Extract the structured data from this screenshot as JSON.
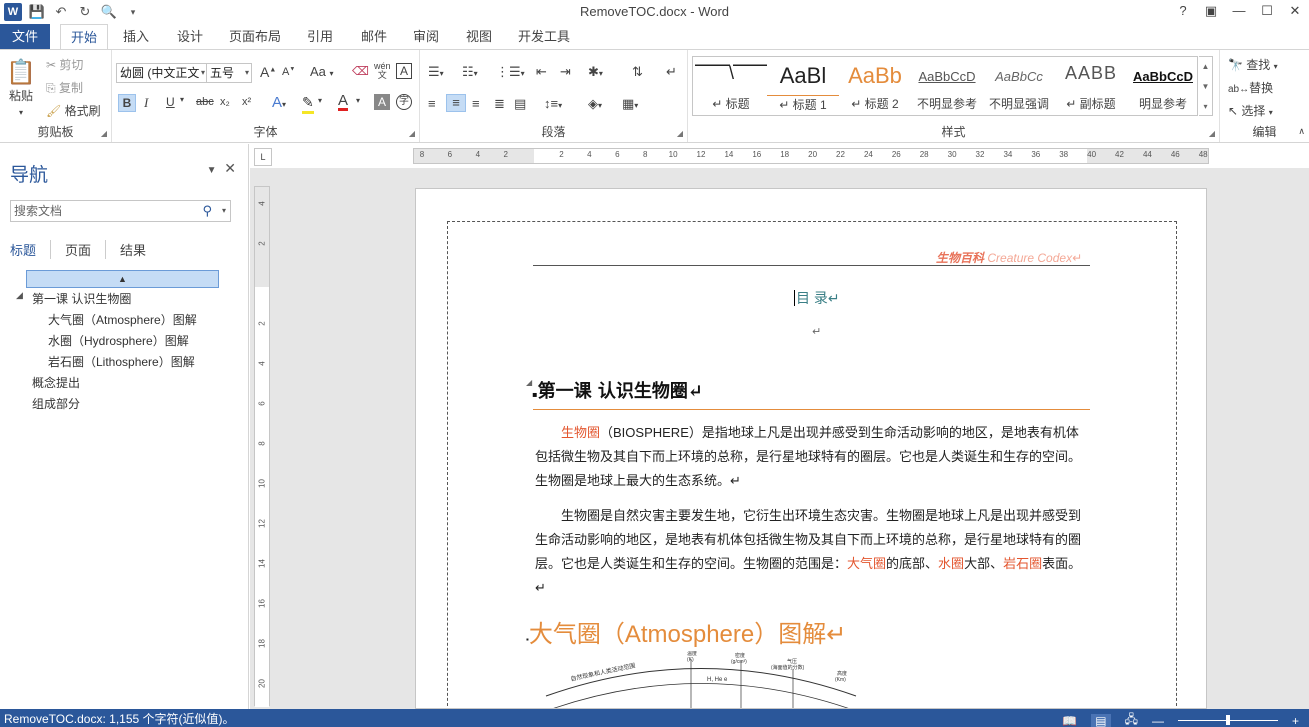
{
  "window": {
    "title": "RemoveTOC.docx - Word",
    "help": "?",
    "controls": [
      "?",
      "▣",
      "—",
      "☐",
      "✕"
    ]
  },
  "tabs": [
    "文件",
    "开始",
    "插入",
    "设计",
    "页面布局",
    "引用",
    "邮件",
    "审阅",
    "视图",
    "开发工具"
  ],
  "ribbon": {
    "clipboard": {
      "label": "剪贴板",
      "paste": "粘贴",
      "cut": "剪切",
      "copy": "复制",
      "format_painter": "格式刷"
    },
    "font": {
      "label": "字体",
      "font_name": "幼圆 (中文正文",
      "font_size": "五号",
      "bold": "B",
      "italic": "I",
      "underline": "U",
      "strike": "abc",
      "sub": "x₂",
      "sup": "x²",
      "grow": "A",
      "shrink": "A",
      "case": "Aa",
      "phonetic": "wén"
    },
    "paragraph": {
      "label": "段落"
    },
    "styles": {
      "label": "样式",
      "items": [
        {
          "sample": "⎺⎺\\⎺⎺",
          "name": "↵ 标题"
        },
        {
          "sample": "AaBl",
          "name": "↵ 标题 1"
        },
        {
          "sample": "AaBb",
          "name": "↵ 标题 2"
        },
        {
          "sample": "AaBbCcD",
          "name": "不明显参考"
        },
        {
          "sample": "AaBbCc",
          "name": "不明显强调"
        },
        {
          "sample": "AABB",
          "name": "↵ 副标题"
        },
        {
          "sample": "AaBbCcD",
          "name": "明显参考"
        }
      ]
    },
    "editing": {
      "label": "编辑",
      "find": "查找",
      "replace": "替换",
      "select": "选择"
    }
  },
  "nav": {
    "title": "导航",
    "search_placeholder": "搜索文档",
    "tabs": [
      "标题",
      "页面",
      "结果"
    ],
    "items": [
      {
        "text": "第一课  认识生物圈",
        "level": 1,
        "expanded": true
      },
      {
        "text": "大气圈（Atmosphere）图解",
        "level": 2
      },
      {
        "text": "水圈（Hydrosphere）图解",
        "level": 2
      },
      {
        "text": "岩石圈（Lithosphere）图解",
        "level": 2
      },
      {
        "text": "概念提出",
        "level": 1
      },
      {
        "text": "组成部分",
        "level": 1
      }
    ]
  },
  "hruler": [
    "8",
    "6",
    "4",
    "2",
    "",
    "2",
    "4",
    "6",
    "8",
    "10",
    "12",
    "14",
    "16",
    "18",
    "20",
    "22",
    "24",
    "26",
    "28",
    "30",
    "32",
    "34",
    "36",
    "38",
    "40",
    "42",
    "44",
    "46",
    "48"
  ],
  "vruler": [
    "4",
    "2",
    "",
    "2",
    "4",
    "6",
    "8",
    "10",
    "12",
    "14",
    "16",
    "18",
    "20"
  ],
  "document": {
    "header_cn": "生物百科",
    "header_en": "Creature Codex↵",
    "toc_title": "目 录↵",
    "blank": "↵",
    "h1": "第一课  认识生物圈↵",
    "p1_a": "生物圈",
    "p1_b": "（BIOSPHERE）是指地球上凡是出现并感受到生命活动影响的地区，是地表有机体包括微生物及其自下而上环境的总称，是行星地球特有的圈层。它也是人类诞生和生存的空间。生物圈是地球上最大的生态系统。↵",
    "p2_a": "生物圈是自然灾害主要发生地，它衍生出环境生态灾害。生物圈是地球上凡是出现并感受到生命活动影响的地区，是地表有机体包括微生物及其自下而上环境的总称，是行星地球特有的圈层。它也是人类诞生和生存的空间。生物圈的范围是：",
    "p2_hl1": "大气圈",
    "p2_b": "的底部、",
    "p2_hl2": "水圈",
    "p2_c": "大部、",
    "p2_hl3": "岩石圈",
    "p2_d": "表面。↵",
    "h2": "大气圈（Atmosphere）图解↵",
    "diagram": {
      "arc_label": "自然现象和人类活动范围",
      "c1": "温度",
      "c1u": "(K)",
      "c2": "密度",
      "c2u": "(g/cm³)",
      "c3": "气压",
      "c3u": "(海面值的分数)",
      "c4": "高度",
      "c4u": "(Km)",
      "cell": "H, He e"
    }
  },
  "status": {
    "text": "RemoveTOC.docx: 1,155 个字符(近似值)。"
  },
  "colors": {
    "accent": "#2b579a",
    "heading_orange": "#e48c3c",
    "highlight_red": "#e3562f",
    "toc_teal": "#3a7f86"
  }
}
